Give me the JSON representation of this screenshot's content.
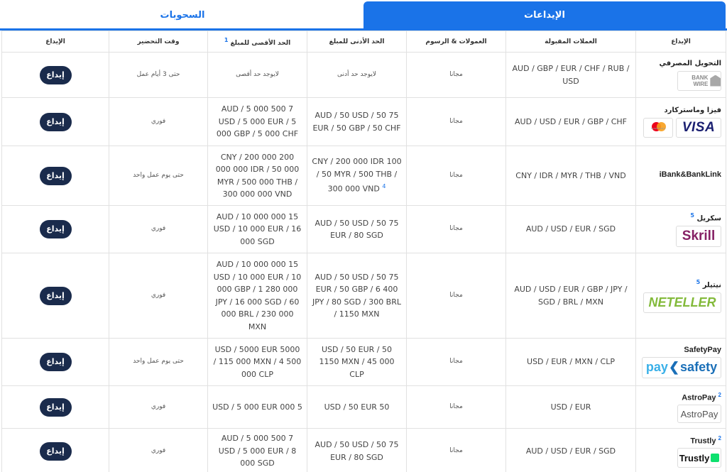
{
  "tabs": {
    "deposits": "الإيداعات",
    "withdrawals": "السحوبات"
  },
  "headers": {
    "method": "الإيداع",
    "currencies": "العملات المقبولة",
    "fees": "العمولات & الرسوم",
    "min": "الحد الأدنى للمبلغ",
    "max": "الحد الأقصى للمبلغ",
    "max_note": "1",
    "time": "وقت التحضير",
    "action": "الإيداع"
  },
  "deposit_label": "إيداع",
  "rows": [
    {
      "name": "التحويل المصرفي",
      "note": "",
      "logo": "bank-wire-logo",
      "logo_text": "BANK WIRE",
      "currencies": "AUD / GBP / EUR / CHF / RUB / USD",
      "fees": "مجانا",
      "min": "لايوجد حد أدنى",
      "min_note": "",
      "max": "لايوجد حد أقصى",
      "time": "حتى 3 أيام عمل"
    },
    {
      "name": "فيزا وماستركارد",
      "note": "",
      "logo": "visa-mastercard-logo",
      "logo_text": "VISA",
      "logo_text2": "mastercard",
      "currencies": "AUD / USD / EUR / GBP / CHF",
      "fees": "مجانا",
      "min": "75 AUD / 50 USD / 50 EUR / 50 GBP / 50 CHF",
      "min_note": "",
      "max": "7 500 AUD / 5 000 USD / 5 000 EUR / 5 000 GBP / 5 000 CHF",
      "time": "فوري"
    },
    {
      "name": "iBank&BankLink",
      "note": "",
      "logo": "",
      "currencies": "CNY / IDR / MYR / THB / VND",
      "fees": "مجانا",
      "min": "100 CNY / 200 000 IDR / 50 MYR / 500 THB / 300 000 VND",
      "min_note": "4",
      "max": "200 000 CNY / 200 000 000 IDR / 50 000 MYR / 500 000 THB / 300 000 000 VND",
      "time": "حتى يوم عمل واحد"
    },
    {
      "name": "سكريل",
      "note": "5",
      "logo": "skrill-logo",
      "logo_text": "Skrill",
      "currencies": "AUD / USD / EUR / SGD",
      "fees": "مجانا",
      "min": "75 AUD / 50 USD / 50 EUR / 80 SGD",
      "min_note": "",
      "max": "15 000 AUD / 10 000 USD / 10 000 EUR / 16 000 SGD",
      "time": "فوري"
    },
    {
      "name": "نيتيلر",
      "note": "5",
      "logo": "neteller-logo",
      "logo_text": "NETELLER",
      "currencies": "AUD / USD / EUR / GBP / JPY / SGD / BRL / MXN",
      "fees": "مجانا",
      "min": "75 AUD / 50 USD / 50 EUR / 50 GBP / 6 400 JPY / 80 SGD / 300 BRL / 1150 MXN",
      "min_note": "",
      "max": "15 000 AUD / 10 000 USD / 10 000 EUR / 10 000 GBP / 1 280 000 JPY / 16 000 SGD / 60 000 BRL / 230 000 MXN",
      "time": "فوري"
    },
    {
      "name": "SafetyPay",
      "note": "",
      "logo": "safetypay-logo",
      "logo_text": "safety",
      "logo_text2": "pay",
      "currencies": "USD / EUR / MXN / CLP",
      "fees": "مجانا",
      "min": "50 USD / 50 EUR / 1150 MXN / 45 000 CLP",
      "min_note": "",
      "max": "5000 USD / 5000 EUR / 115 000 MXN / 4 500 000 CLP",
      "time": "حتى يوم عمل واحد"
    },
    {
      "name": "AstroPay",
      "note": "2",
      "logo": "astropay-logo",
      "logo_text": "AstroPay",
      "currencies": "USD / EUR",
      "fees": "مجانا",
      "min": "50 USD / 50 EUR",
      "min_note": "",
      "max": "5 000 USD / 5 000 EUR",
      "time": "فوري"
    },
    {
      "name": "Trustly",
      "note": "2",
      "logo": "trustly-logo",
      "logo_text": "Trustly",
      "currencies": "AUD / USD / EUR / SGD",
      "fees": "مجانا",
      "min": "75 AUD / 50 USD / 50 EUR / 80 SGD",
      "min_note": "",
      "max": "7 500 AUD / 5 000 USD / 5 000 EUR / 8 000 SGD",
      "time": "فوري"
    }
  ],
  "colors": {
    "accent": "#1a73e8",
    "button": "#1a2b4c"
  }
}
